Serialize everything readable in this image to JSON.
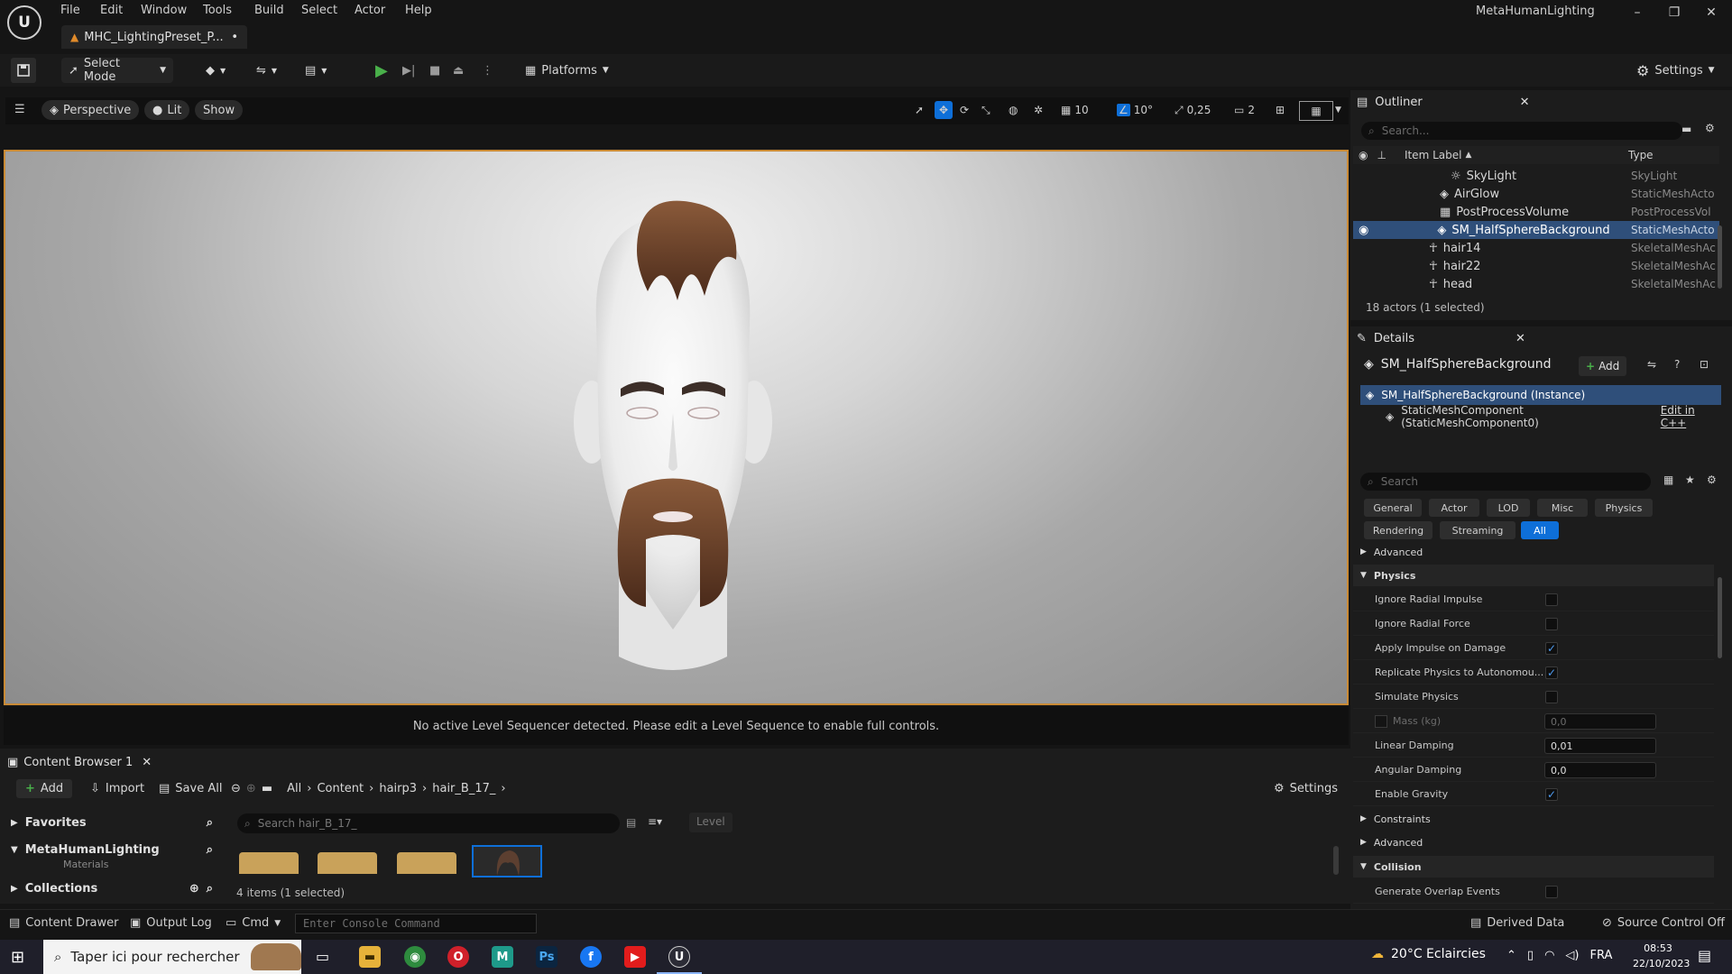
{
  "app": {
    "window_title": "MetaHumanLighting",
    "document_tab": "MHC_LightingPreset_P...",
    "menu": [
      "File",
      "Edit",
      "Window",
      "Tools",
      "Build",
      "Select",
      "Actor",
      "Help"
    ]
  },
  "toolbar": {
    "select_mode": "Select Mode",
    "platforms": "Platforms",
    "settings": "Settings"
  },
  "viewport": {
    "perspective": "Perspective",
    "lit": "Lit",
    "show": "Show",
    "grid_snap": "10",
    "rotation_snap": "10°",
    "scale_snap": "0,25",
    "camera_speed": "2",
    "sequencer_message": "No active Level Sequencer detected. Please edit a Level Sequence to enable full controls."
  },
  "content_browser": {
    "tab_label": "Content Browser 1",
    "add": "Add",
    "import": "Import",
    "save_all": "Save All",
    "breadcrumb": [
      "All",
      "Content",
      "hairp3",
      "hair_B_17_"
    ],
    "settings": "Settings",
    "search_placeholder": "Search hair_B_17_",
    "level_chip": "Level",
    "favorites": "Favorites",
    "project": "MetaHumanLighting",
    "materials": "Materials",
    "collections": "Collections",
    "item_count": "4 items (1 selected)"
  },
  "statusbar": {
    "content_drawer": "Content Drawer",
    "output_log": "Output Log",
    "cmd": "Cmd",
    "console_placeholder": "Enter Console Command",
    "derived_data": "Derived Data",
    "source_control": "Source Control Off"
  },
  "outliner": {
    "title": "Outliner",
    "search_placeholder": "Search...",
    "col_label": "Item Label",
    "col_type": "Type",
    "rows": [
      {
        "label": "SkyLight",
        "type": "SkyLight"
      },
      {
        "label": "AirGlow",
        "type": "StaticMeshActo"
      },
      {
        "label": "PostProcessVolume",
        "type": "PostProcessVol"
      },
      {
        "label": "SM_HalfSphereBackground",
        "type": "StaticMeshActo"
      },
      {
        "label": "hair14",
        "type": "SkeletalMeshAc"
      },
      {
        "label": "hair22",
        "type": "SkeletalMeshAc"
      },
      {
        "label": "head",
        "type": "SkeletalMeshAc"
      }
    ],
    "actor_count": "18 actors (1 selected)"
  },
  "details": {
    "title": "Details",
    "object_name": "SM_HalfSphereBackground",
    "add": "Add",
    "instance": "SM_HalfSphereBackground (Instance)",
    "component": "StaticMeshComponent (StaticMeshComponent0)",
    "edit_cpp": "Edit in C++",
    "search_placeholder": "Search",
    "filters": [
      "General",
      "Actor",
      "LOD",
      "Misc",
      "Physics",
      "Rendering",
      "Streaming",
      "All"
    ],
    "advanced": "Advanced",
    "physics_header": "Physics",
    "props": [
      {
        "label": "Ignore Radial Impulse",
        "checked": false
      },
      {
        "label": "Ignore Radial Force",
        "checked": false
      },
      {
        "label": "Apply Impulse on Damage",
        "checked": true
      },
      {
        "label": "Replicate Physics to Autonomou...",
        "checked": true
      },
      {
        "label": "Simulate Physics",
        "checked": false
      },
      {
        "label": "Mass (kg)",
        "value": "0,0"
      },
      {
        "label": "Linear Damping",
        "value": "0,01"
      },
      {
        "label": "Angular Damping",
        "value": "0,0"
      },
      {
        "label": "Enable Gravity",
        "checked": true
      }
    ],
    "constraints": "Constraints",
    "advanced2": "Advanced",
    "collision_header": "Collision",
    "generate_overlap": "Generate Overlap Events"
  },
  "taskbar": {
    "search_placeholder": "Taper ici pour rechercher",
    "weather": "20°C  Eclaircies",
    "language": "FRA",
    "time": "08:53",
    "date": "22/10/2023"
  },
  "colors": {
    "accent_blue": "#0e6fd8",
    "selection_border": "#c98a35",
    "play_green": "#49b04a"
  }
}
